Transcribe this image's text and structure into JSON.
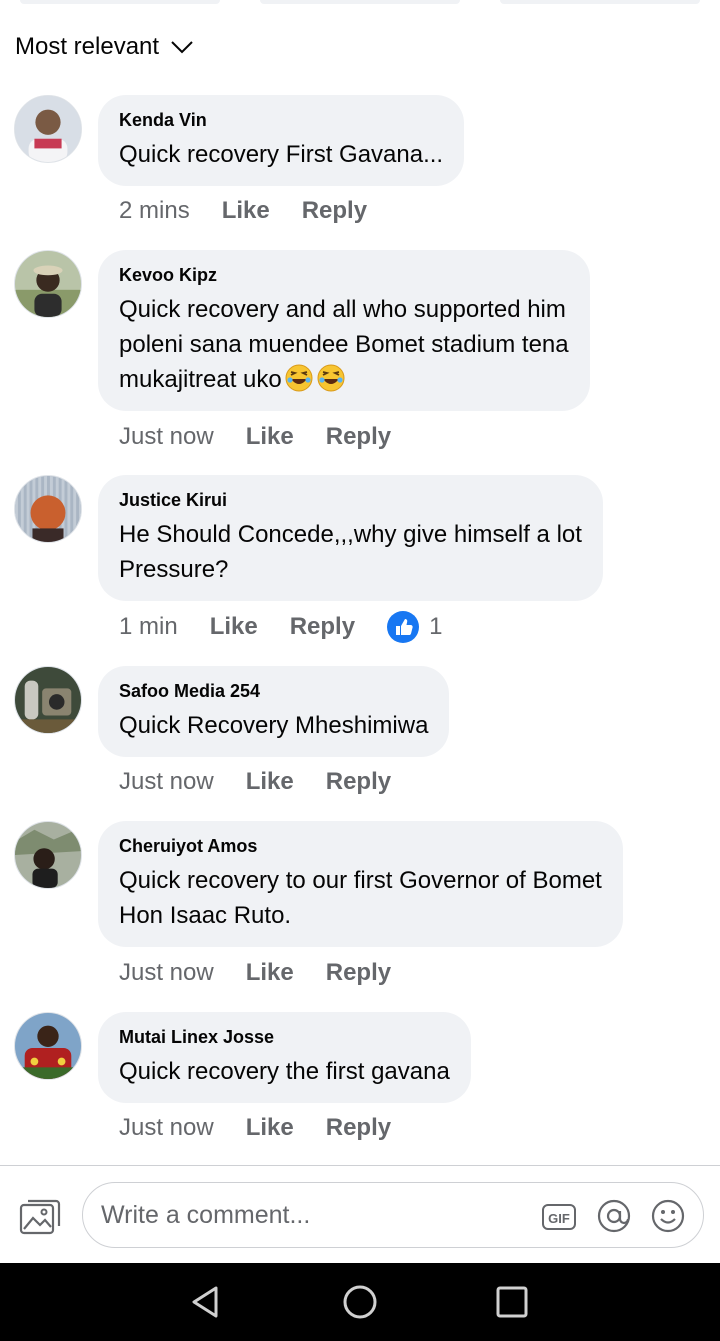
{
  "sort": {
    "label": "Most relevant"
  },
  "comments": [
    {
      "author": "Kenda Vin",
      "text": "Quick recovery First Gavana...",
      "time": "2 mins",
      "like": "Like",
      "reply": "Reply"
    },
    {
      "author": "Kevoo Kipz",
      "text_lines": [
        "Quick recovery and all who supported him",
        "poleni sana muendee Bomet stadium tena",
        "mukajitreat uko"
      ],
      "emoji": "rolling-on-floor-laughing",
      "time": "Just now",
      "like": "Like",
      "reply": "Reply"
    },
    {
      "author": "Justice Kirui",
      "text_lines": [
        "He Should Concede,,,why give himself a lot",
        "Pressure?"
      ],
      "time": "1 min",
      "like": "Like",
      "reply": "Reply",
      "reaction_count": "1"
    },
    {
      "author": "Safoo Media 254",
      "text": "Quick Recovery Mheshimiwa",
      "time": "Just now",
      "like": "Like",
      "reply": "Reply"
    },
    {
      "author": "Cheruiyot Amos",
      "text_lines": [
        "Quick recovery to our first Governor of Bomet",
        "Hon Isaac Ruto."
      ],
      "time": "Just now",
      "like": "Like",
      "reply": "Reply"
    },
    {
      "author": "Mutai Linex Josse",
      "text": "Quick recovery the first gavana",
      "time": "Just now",
      "like": "Like",
      "reply": "Reply"
    }
  ],
  "composer": {
    "placeholder": "Write a comment...",
    "gif_label": "GIF"
  },
  "icons": {
    "sort": "chevron-down-icon",
    "reaction": "thumbs-up-icon",
    "photo": "photo-icon",
    "gif": "gif-icon",
    "mention": "at-icon",
    "emoji": "smiley-icon",
    "nav_back": "triangle-back-icon",
    "nav_home": "circle-home-icon",
    "nav_recents": "square-recents-icon"
  },
  "colors": {
    "accent": "#1877f2",
    "bubble": "#f0f2f5",
    "meta": "#65676b"
  }
}
